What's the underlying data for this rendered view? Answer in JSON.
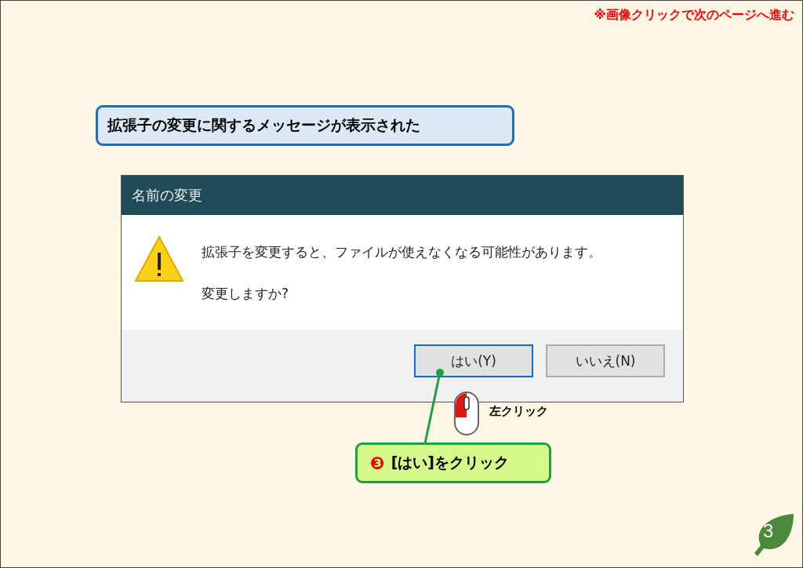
{
  "page_note": "※画像クリックで次のページへ進む",
  "caption": "拡張子の変更に関するメッセージが表示された",
  "dialog": {
    "title": "名前の変更",
    "kind": "warning",
    "message": "拡張子を変更すると、ファイルが使えなくなる可能性があります。",
    "question": "変更しますか?",
    "buttons": [
      {
        "label": "はい(Y)",
        "selected": true
      },
      {
        "label": "いいえ(N)",
        "selected": false
      }
    ]
  },
  "mouse_hint": "左クリック",
  "step": {
    "number": "❸",
    "label": "[はい]をクリック"
  },
  "page_number": "3"
}
